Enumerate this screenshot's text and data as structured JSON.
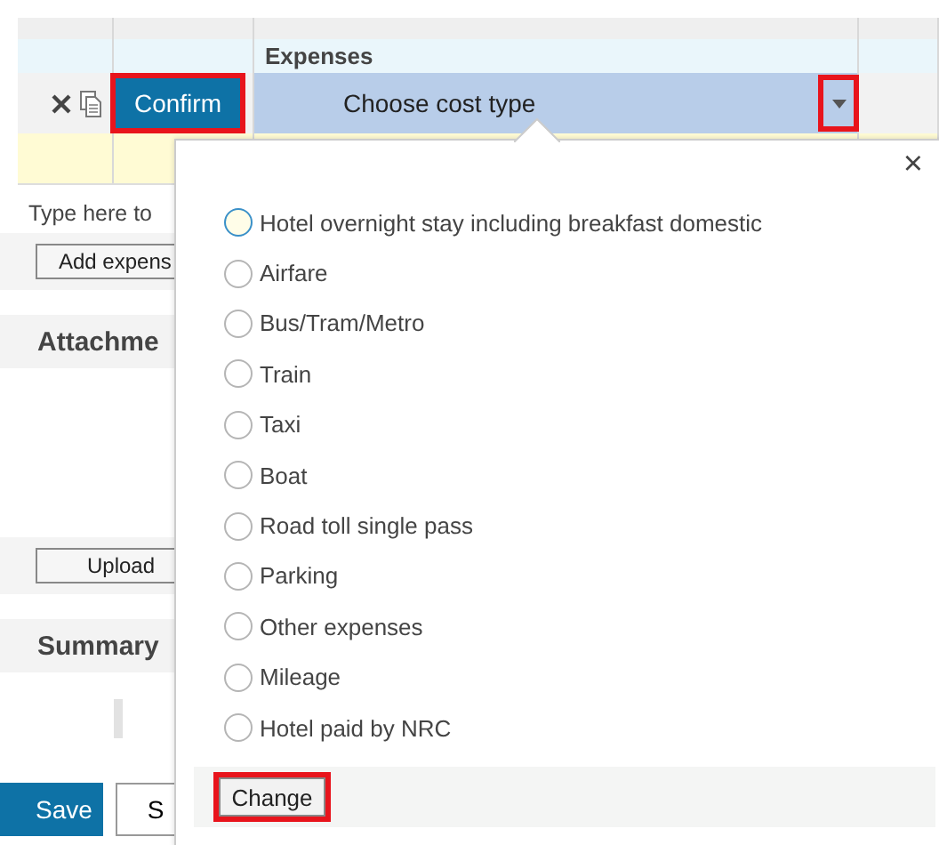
{
  "table": {
    "column_heading": "Expenses",
    "row": {
      "confirm": {
        "label": "Confirm",
        "highlighted": true
      },
      "select": {
        "value": "Choose cost type",
        "arrow_highlighted": true
      }
    }
  },
  "left": {
    "hint": "Type here to",
    "add_button": "Add expens",
    "attachments_heading": "Attachme",
    "upload_button": "Upload",
    "summary_heading": "Summary",
    "save_button": "Save",
    "second_button": "S"
  },
  "popup": {
    "close": "×",
    "options": [
      {
        "label": "Hotel overnight stay including breakfast domestic",
        "focused": true
      },
      {
        "label": "Airfare",
        "focused": false
      },
      {
        "label": "Bus/Tram/Metro",
        "focused": false
      },
      {
        "label": "Train",
        "focused": false
      },
      {
        "label": "Taxi",
        "focused": false
      },
      {
        "label": "Boat",
        "focused": false
      },
      {
        "label": "Road toll single pass",
        "focused": false
      },
      {
        "label": "Parking",
        "focused": false
      },
      {
        "label": "Other expenses",
        "focused": false
      },
      {
        "label": "Mileage",
        "focused": false
      },
      {
        "label": "Hotel paid by NRC",
        "focused": false
      }
    ],
    "change": {
      "label": "Change",
      "highlighted": true
    }
  }
}
